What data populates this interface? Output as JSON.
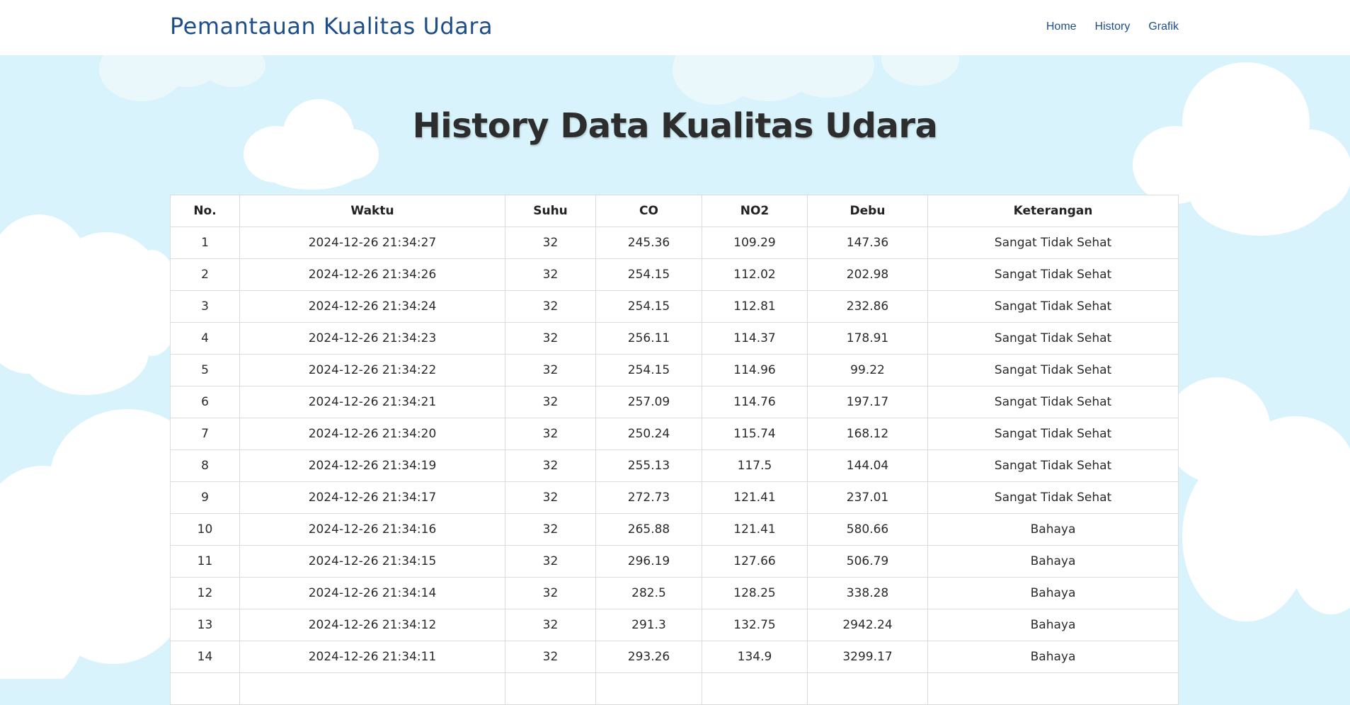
{
  "navbar": {
    "brand": "Pemantauan Kualitas Udara",
    "links": [
      "Home",
      "History",
      "Grafik"
    ]
  },
  "page": {
    "title": "History Data Kualitas Udara"
  },
  "table": {
    "headers": [
      "No.",
      "Waktu",
      "Suhu",
      "CO",
      "NO2",
      "Debu",
      "Keterangan"
    ],
    "rows": [
      [
        "1",
        "2024-12-26 21:34:27",
        "32",
        "245.36",
        "109.29",
        "147.36",
        "Sangat Tidak Sehat"
      ],
      [
        "2",
        "2024-12-26 21:34:26",
        "32",
        "254.15",
        "112.02",
        "202.98",
        "Sangat Tidak Sehat"
      ],
      [
        "3",
        "2024-12-26 21:34:24",
        "32",
        "254.15",
        "112.81",
        "232.86",
        "Sangat Tidak Sehat"
      ],
      [
        "4",
        "2024-12-26 21:34:23",
        "32",
        "256.11",
        "114.37",
        "178.91",
        "Sangat Tidak Sehat"
      ],
      [
        "5",
        "2024-12-26 21:34:22",
        "32",
        "254.15",
        "114.96",
        "99.22",
        "Sangat Tidak Sehat"
      ],
      [
        "6",
        "2024-12-26 21:34:21",
        "32",
        "257.09",
        "114.76",
        "197.17",
        "Sangat Tidak Sehat"
      ],
      [
        "7",
        "2024-12-26 21:34:20",
        "32",
        "250.24",
        "115.74",
        "168.12",
        "Sangat Tidak Sehat"
      ],
      [
        "8",
        "2024-12-26 21:34:19",
        "32",
        "255.13",
        "117.5",
        "144.04",
        "Sangat Tidak Sehat"
      ],
      [
        "9",
        "2024-12-26 21:34:17",
        "32",
        "272.73",
        "121.41",
        "237.01",
        "Sangat Tidak Sehat"
      ],
      [
        "10",
        "2024-12-26 21:34:16",
        "32",
        "265.88",
        "121.41",
        "580.66",
        "Bahaya"
      ],
      [
        "11",
        "2024-12-26 21:34:15",
        "32",
        "296.19",
        "127.66",
        "506.79",
        "Bahaya"
      ],
      [
        "12",
        "2024-12-26 21:34:14",
        "32",
        "282.5",
        "128.25",
        "338.28",
        "Bahaya"
      ],
      [
        "13",
        "2024-12-26 21:34:12",
        "32",
        "291.3",
        "132.75",
        "2942.24",
        "Bahaya"
      ],
      [
        "14",
        "2024-12-26 21:34:11",
        "32",
        "293.26",
        "134.9",
        "3299.17",
        "Bahaya"
      ],
      [
        "",
        "",
        "",
        "",
        "",
        "",
        ""
      ]
    ]
  },
  "colors": {
    "sky": "#d8f3fb",
    "brand": "#1d4e89",
    "title": "#2d2d2d"
  }
}
